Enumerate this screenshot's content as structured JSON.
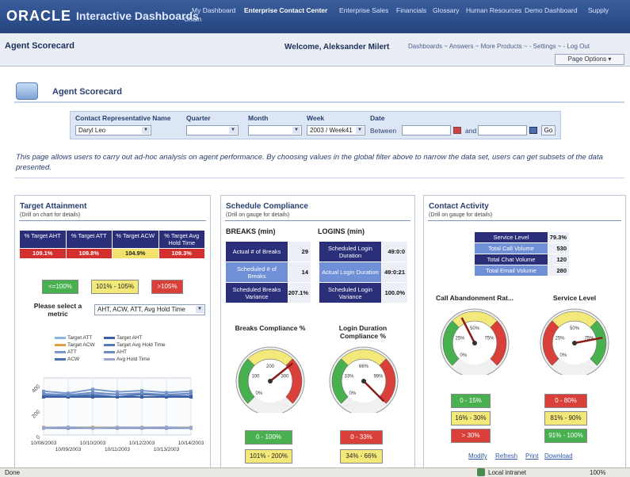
{
  "topbar": {
    "logo": "ORACLE",
    "app_title": "Interactive Dashboards",
    "nav": [
      "My Dashboard",
      "Enterprise Contact Center",
      "Enterprise Sales",
      "Financials",
      "Glossary",
      "Human Resources",
      "Demo Dashboard",
      "Supply"
    ],
    "nav_extra": "Chain"
  },
  "subbar": {
    "page_title": "Agent Scorecard",
    "welcome": "Welcome, Aleksander Milert",
    "links": "Dashboards ~ Answers ~ More Products ~ - Settings ~ - Log Out",
    "page_options": "Page Options ▾"
  },
  "section": {
    "title": "Agent Scorecard"
  },
  "filters": {
    "rep_label": "Contact Representative Name",
    "rep_value": "Daryl Leo",
    "quarter_label": "Quarter",
    "quarter_value": "",
    "month_label": "Month",
    "month_value": "",
    "week_label": "Week",
    "week_value": "2003 / Week41",
    "date_label": "Date",
    "between": "Between",
    "and": "and",
    "go": "Go"
  },
  "description": "This page allows users to carry out ad-hoc analysis on agent performance. By choosing values in the global filter above to narrow the data set, users can get subsets of the data presented.",
  "target": {
    "title": "Target Attainment",
    "subtitle": "(Drill on chart for details)",
    "headers": [
      "% Target AHT",
      "% Target ATT",
      "% Target ACW",
      "% Target Avg Hold Time"
    ],
    "values": [
      "109.1%",
      "109.8%",
      "104.9%",
      "109.3%"
    ],
    "value_colors": [
      "#d32f2f",
      "#d32f2f",
      "#f2e26b",
      "#d32f2f"
    ],
    "legend": [
      "<=100%",
      "101% - 105%",
      ">105%"
    ],
    "metric_label": "Please select a metric",
    "metric_value": "AHT, ACW, ATT, Avg Hold Time",
    "chart_legend": [
      "Target ATT",
      "Target ACW",
      "ATT",
      "ACW",
      "Target AHT",
      "Target Avg Hold Time",
      "AHT",
      "Avg Hold Time"
    ]
  },
  "chart_data": {
    "type": "line",
    "x": [
      "10/08/2003",
      "10/09/2003",
      "10/10/2003",
      "10/11/2003",
      "10/12/2003",
      "10/13/2003",
      "10/14/2003"
    ],
    "x_ticks_top": [
      "10/08/2003",
      "10/10/2003",
      "10/12/2003",
      "10/14/2003"
    ],
    "x_ticks_bottom": [
      "10/09/2003",
      "10/11/2003",
      "10/13/2003"
    ],
    "y_ticks": [
      "400",
      "200",
      "0"
    ],
    "ylim": [
      0,
      450
    ],
    "series": [
      {
        "name": "Target ATT",
        "values": [
          320,
          320,
          320,
          320,
          320,
          320,
          320
        ],
        "color": "#8fb3e0"
      },
      {
        "name": "Target ACW",
        "values": [
          60,
          60,
          60,
          60,
          60,
          60,
          60
        ],
        "color": "#e0a040"
      },
      {
        "name": "ATT",
        "values": [
          345,
          330,
          360,
          340,
          350,
          335,
          345
        ],
        "color": "#7a9acc"
      },
      {
        "name": "ACW",
        "values": [
          310,
          305,
          315,
          300,
          320,
          310,
          305
        ],
        "color": "#4a6fb0"
      },
      {
        "name": "Target AHT",
        "values": [
          300,
          300,
          300,
          300,
          300,
          300,
          300
        ],
        "color": "#3a60a8"
      },
      {
        "name": "Target Avg Hold Time",
        "values": [
          55,
          55,
          55,
          55,
          55,
          55,
          55
        ],
        "color": "#5578b8"
      },
      {
        "name": "AHT",
        "values": [
          325,
          315,
          335,
          320,
          330,
          318,
          328
        ],
        "color": "#6d8cc4"
      },
      {
        "name": "Avg Hold Time",
        "values": [
          58,
          62,
          57,
          60,
          59,
          61,
          58
        ],
        "color": "#9aa9c9"
      }
    ]
  },
  "schedule": {
    "title": "Schedule Compliance",
    "subtitle": "(Drill on gauge for details)",
    "breaks_title": "BREAKS (min)",
    "logins_title": "LOGINS (min)",
    "breaks_rows": [
      {
        "label": "Actual # of Breaks",
        "value": "29"
      },
      {
        "label": "Scheduled # of Breaks",
        "value": "14"
      },
      {
        "label": "Scheduled Breaks Variance",
        "value": "207.1%"
      }
    ],
    "logins_rows": [
      {
        "label": "Scheduled Login Duration",
        "value": "49:0:0"
      },
      {
        "label": "Actual Login Duration",
        "value": "49:0:21"
      },
      {
        "label": "Scheduled Login Variance",
        "value": "100.0%"
      }
    ],
    "gauge1_title": "Breaks Compliance %",
    "gauge2_title": "Login Duration Compliance %",
    "gauge1_ticks": [
      "0%",
      "100",
      "200",
      "300"
    ],
    "gauge2_ticks": [
      "0%",
      "33%",
      "66%",
      "99%"
    ],
    "gauge1_value": 207.1,
    "gauge2_value": 100,
    "legend1": [
      "0 - 100%",
      "101% - 200%"
    ],
    "legend2": [
      "0 - 33%",
      "34% - 66%"
    ]
  },
  "contact": {
    "title": "Contact Activity",
    "subtitle": "(Drill on gauge for details)",
    "rows": [
      {
        "label": "Service Level",
        "value": "79.3%"
      },
      {
        "label": "Total Call Volume",
        "value": "530"
      },
      {
        "label": "Total Chat Volume",
        "value": "120"
      },
      {
        "label": "Total Email Volume",
        "value": "280"
      }
    ],
    "gauge1_title": "Call Abandonment Rat...",
    "gauge2_title": "Service Level",
    "gauge1_ticks": [
      "0%",
      "25%",
      "50%",
      "75%"
    ],
    "gauge2_ticks": [
      "0%",
      "25%",
      "50%",
      "75%"
    ],
    "gauge1_value": 40,
    "gauge2_value": 79.3,
    "legend1": [
      "0 - 15%",
      "16% - 30%",
      "> 30%"
    ],
    "legend2": [
      "0 - 80%",
      "81% - 90%",
      "91% - 100%"
    ],
    "links": [
      "Modify",
      "Refresh",
      "Print",
      "Download"
    ]
  },
  "status": {
    "left": "Done",
    "zone": "Local intranet",
    "zoom": "100%"
  }
}
